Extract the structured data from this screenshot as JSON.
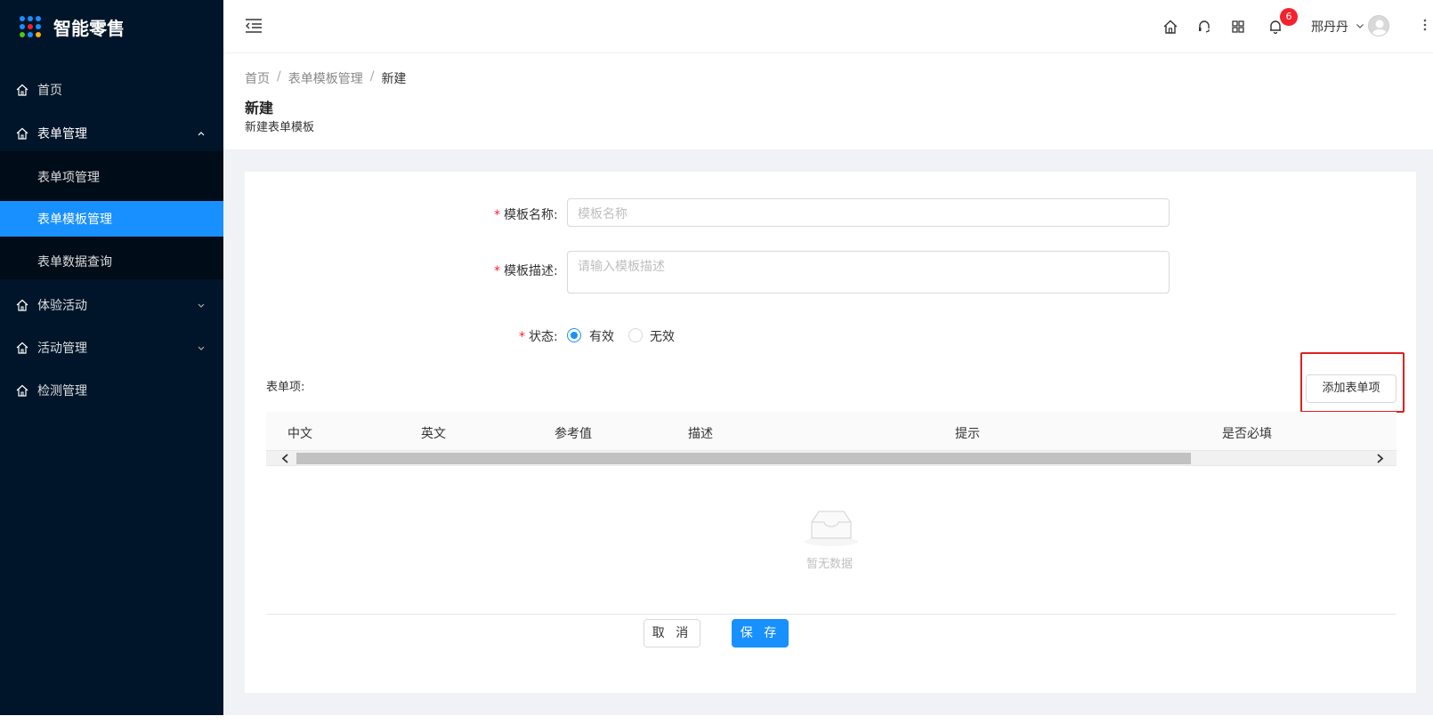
{
  "app": {
    "title": "智能零售"
  },
  "sidebar": {
    "items": [
      {
        "label": "首页"
      },
      {
        "label": "表单管理",
        "children": [
          {
            "label": "表单项管理"
          },
          {
            "label": "表单模板管理",
            "active": true
          },
          {
            "label": "表单数据查询"
          }
        ]
      },
      {
        "label": "体验活动"
      },
      {
        "label": "活动管理"
      },
      {
        "label": "检测管理"
      }
    ]
  },
  "header": {
    "notification_count": "6",
    "username": "邢丹丹",
    "icons": [
      "home-icon",
      "headset-icon",
      "apps-icon",
      "bell-icon",
      "more-icon"
    ]
  },
  "breadcrumb": [
    "首页",
    "表单模板管理",
    "新建"
  ],
  "page": {
    "title": "新建",
    "subtitle": "新建表单模板"
  },
  "form": {
    "name_label": "模板名称:",
    "name_placeholder": "模板名称",
    "desc_label": "模板描述:",
    "desc_placeholder": "请输入模板描述",
    "status_label": "状态:",
    "status_options": [
      "有效",
      "无效"
    ],
    "status_selected": "有效",
    "items_label": "表单项:",
    "add_button": "添加表单项"
  },
  "table": {
    "columns": [
      "中文",
      "英文",
      "参考值",
      "描述",
      "提示",
      "是否必填"
    ],
    "empty_text": "暂无数据"
  },
  "actions": {
    "cancel": "取 消",
    "save": "保 存"
  },
  "colors": {
    "sidebar_bg": "#001529",
    "primary": "#1890ff",
    "badge": "#f5222d",
    "highlight": "#e02020"
  }
}
